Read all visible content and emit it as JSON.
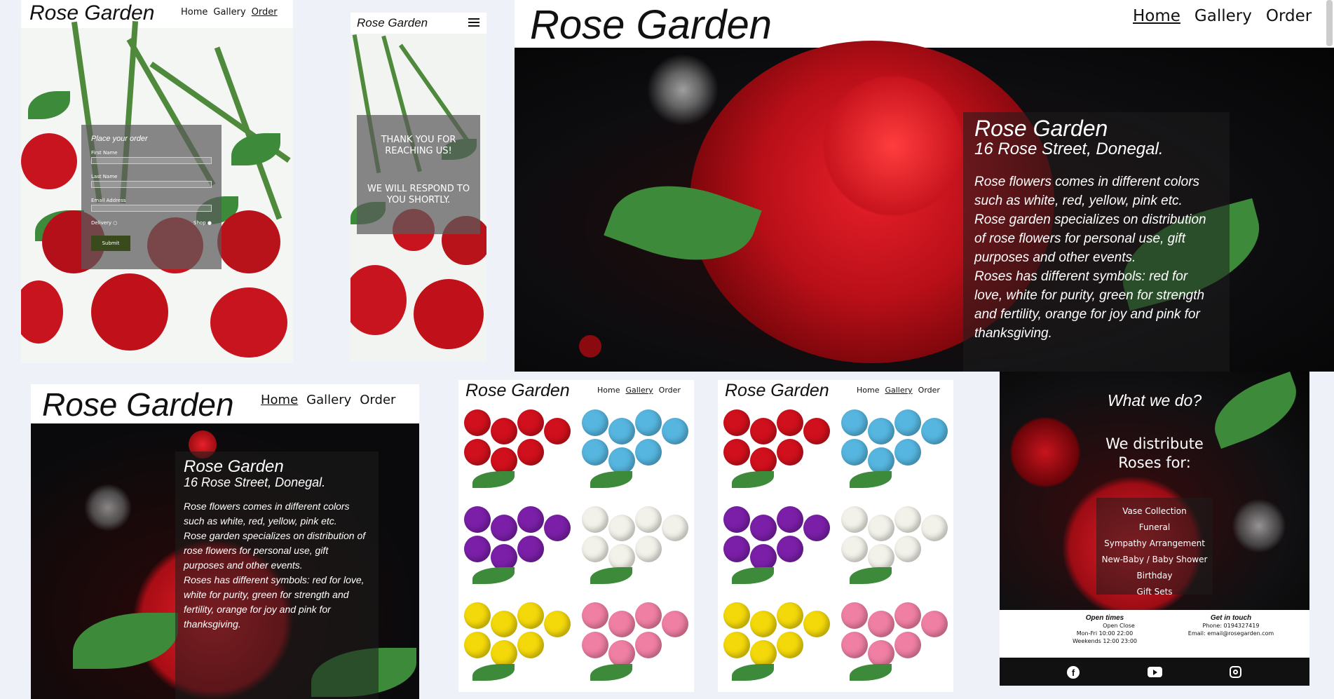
{
  "brand": "Rose Garden",
  "nav": {
    "home": "Home",
    "gallery": "Gallery",
    "order": "Order"
  },
  "menu_icon": "hamburger-menu-icon",
  "order_form": {
    "title": "Place your order",
    "first_name": "First Name",
    "last_name": "Last Name",
    "email": "Email Address",
    "delivery": "Delivery",
    "shop": "Shop",
    "submit": "Submit"
  },
  "thanks": {
    "line1": "THANK YOU FOR REACHING US!",
    "line2": "WE WILL RESPOND TO YOU SHORTLY."
  },
  "hero": {
    "name": "Rose Garden",
    "address": "16 Rose Street, Donegal.",
    "p1": "Rose flowers comes in different colors such as white, red, yellow, pink etc.",
    "p2": "Rose garden specializes on distribution of rose flowers for personal use, gift purposes and other events.",
    "p3": "Roses has different symbols: red for love, white for purity, green for strength and fertility, orange for joy and pink for thanksgiving."
  },
  "gallery_colors": [
    "#d0101c",
    "#56b6e0",
    "#7b1fa8",
    "#f2f2ea",
    "#f4d90a",
    "#f07fa4"
  ],
  "services": {
    "title": "What we do?",
    "subtitle": "We distribute Roses for:",
    "items": [
      "Vase Collection",
      "Funeral",
      "Sympathy Arrangement",
      "New-Baby / Baby Shower",
      "Birthday",
      "Gift Sets"
    ]
  },
  "footer": {
    "open_title": "Open times",
    "open_head": "Open Close",
    "weekday": "Mon-Fri   10:00 22:00",
    "weekend": "Weekends 12:00 23:00",
    "contact_title": "Get in touch",
    "phone": "Phone: 0194327419",
    "email": "Email: email@rosegarden.com",
    "icons": [
      "facebook-icon",
      "youtube-icon",
      "instagram-icon"
    ]
  },
  "colors": {
    "rose_red": "#c8141e",
    "leaf_green": "#3d8a3a",
    "submit_bg": "#3b4a1c",
    "footer_bg": "#111111"
  }
}
